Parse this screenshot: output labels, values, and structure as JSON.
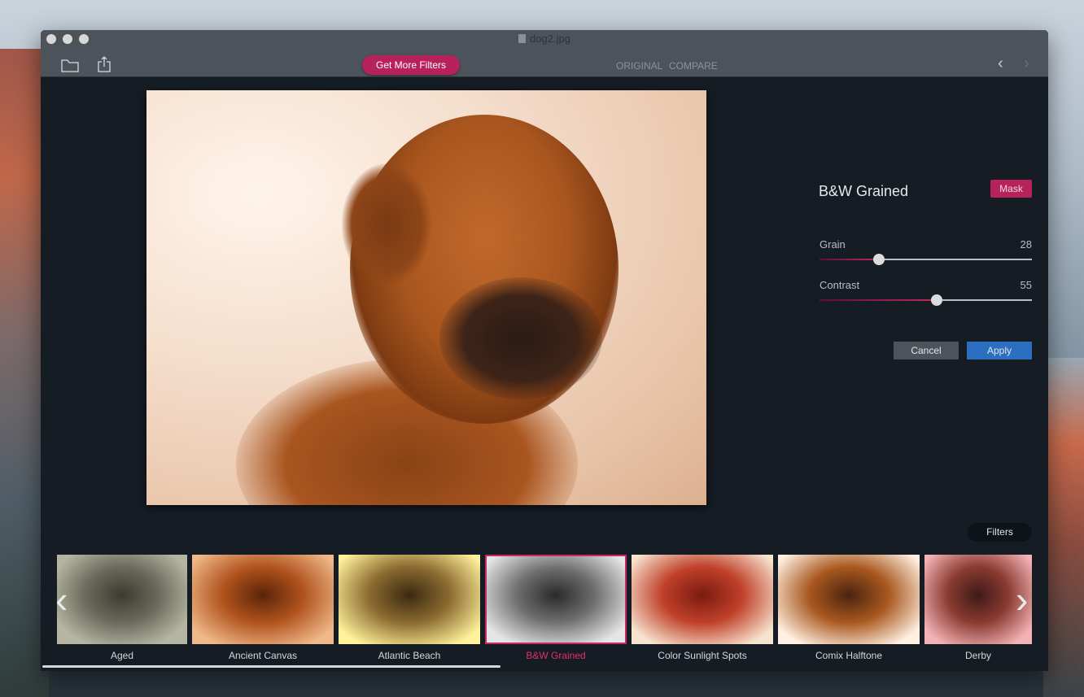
{
  "window": {
    "title": "dog2.jpg"
  },
  "toolbar": {
    "open_icon": "folder-icon",
    "share_icon": "share-icon",
    "get_more_label": "Get More Filters",
    "original_label": "ORIGINAL",
    "compare_label": "COMPARE",
    "back_icon": "chevron-left-icon",
    "forward_icon": "chevron-right-icon"
  },
  "panel": {
    "filter_name": "B&W Grained",
    "mask_label": "Mask",
    "sliders": [
      {
        "label": "Grain",
        "value": "28",
        "fraction": 0.28
      },
      {
        "label": "Contrast",
        "value": "55",
        "fraction": 0.55
      }
    ],
    "cancel_label": "Cancel",
    "apply_label": "Apply"
  },
  "strip": {
    "filters_label": "Filters",
    "items": [
      {
        "label": "Aged",
        "tone": "aged"
      },
      {
        "label": "Ancient Canvas",
        "tone": "canvas"
      },
      {
        "label": "Atlantic Beach",
        "tone": "beach"
      },
      {
        "label": "B&W Grained",
        "tone": "bw",
        "selected": true
      },
      {
        "label": "Color Sunlight Spots",
        "tone": "spots"
      },
      {
        "label": "Comix Halftone",
        "tone": "comix"
      },
      {
        "label": "Derby",
        "tone": "derby"
      }
    ]
  },
  "colors": {
    "accent": "#b8225a",
    "apply": "#2a6fc0",
    "cancel": "#4c535b"
  }
}
